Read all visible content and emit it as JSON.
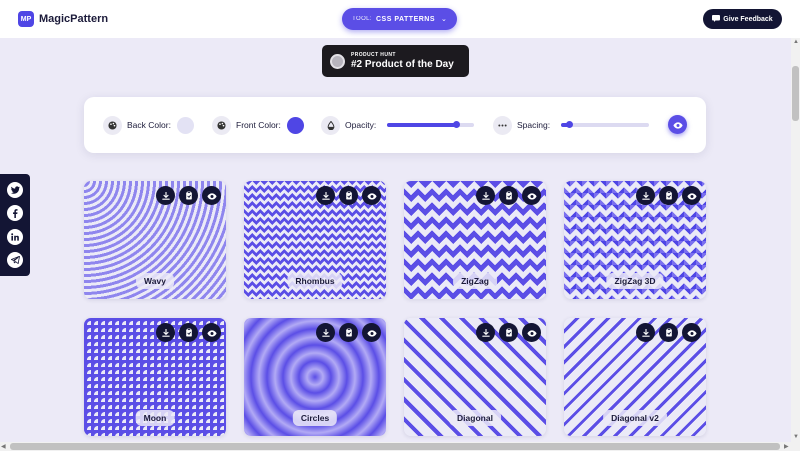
{
  "header": {
    "logo_mark": "MP",
    "logo_text": "MagicPattern",
    "tool_prefix": "TOOL:",
    "tool_name": "CSS PATTERNS",
    "feedback_label": "Give Feedback"
  },
  "product_hunt": {
    "small_label": "PRODUCT HUNT",
    "title": "#2 Product of the Day"
  },
  "controls": {
    "back_color_label": "Back Color:",
    "front_color_label": "Front Color:",
    "opacity_label": "Opacity:",
    "spacing_label": "Spacing:",
    "back_color": "#e3e2f4",
    "front_color": "#4f46e5",
    "opacity_value": 0.8,
    "spacing_value": 0.1
  },
  "social": [
    "twitter-icon",
    "facebook-icon",
    "linkedin-icon",
    "telegram-icon"
  ],
  "patterns": [
    {
      "name": "Wavy",
      "class": "pat-wavy"
    },
    {
      "name": "Rhombus",
      "class": "pat-rhombus"
    },
    {
      "name": "ZigZag",
      "class": "pat-zigzag"
    },
    {
      "name": "ZigZag 3D",
      "class": "pat-zigzag3d"
    },
    {
      "name": "Moon",
      "class": "pat-moon"
    },
    {
      "name": "Circles",
      "class": "pat-circles"
    },
    {
      "name": "Diagonal",
      "class": "pat-diagonal"
    },
    {
      "name": "Diagonal v2",
      "class": "pat-diagonal2"
    }
  ],
  "colors": {
    "accent": "#4f46e5",
    "dark": "#131534",
    "background": "#eceaf7"
  }
}
